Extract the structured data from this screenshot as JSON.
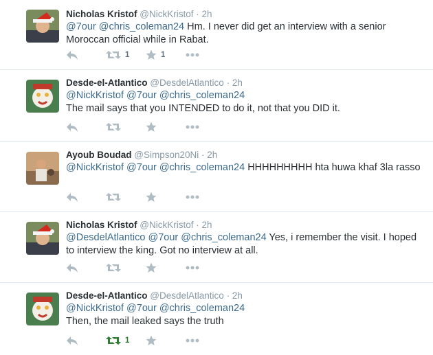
{
  "colors": {
    "mention": "#3b6a8c",
    "muted": "#8899a6",
    "icon": "#b0bcc4",
    "retweet_active": "#2e7d32",
    "divider": "#e1e8ed"
  },
  "tweets": [
    {
      "fullname": "Nicholas Kristof",
      "handle": "@NickKristof",
      "dot": "·",
      "time": "2h",
      "parts": [
        "@7our",
        " ",
        "@chris_coleman24",
        " Hm. I never did get an interview with a senior Moroccan official while in Rabat."
      ],
      "retweet_count": "1",
      "favorite_count": "1",
      "retweeted": false
    },
    {
      "fullname": "Desde-el-Atlantico",
      "handle": "@DesdelAtlantico",
      "dot": "·",
      "time": "2h",
      "parts": [
        "@NickKristof",
        " ",
        "@7our",
        " ",
        "@chris_coleman24",
        "The mail says that you INTENDED to do it, not that you DID it."
      ],
      "retweet_count": "",
      "favorite_count": "",
      "retweeted": false
    },
    {
      "fullname": "Ayoub Boudad",
      "handle": "@Simpson20Ni",
      "dot": "·",
      "time": "2h",
      "parts": [
        "@NickKristof",
        " ",
        "@7our",
        " ",
        "@chris_coleman24",
        " HHHHHHHHH hta huwa khaf 3la rasso"
      ],
      "retweet_count": "",
      "favorite_count": "",
      "retweeted": false
    },
    {
      "fullname": "Nicholas Kristof",
      "handle": "@NickKristof",
      "dot": "·",
      "time": "2h",
      "parts": [
        "@DesdelAtlantico",
        " ",
        "@7our",
        " ",
        "@chris_coleman24",
        " Yes, i remember the visit. I hoped to interview the king. Got no interview at all."
      ],
      "retweet_count": "",
      "favorite_count": "",
      "retweeted": false
    },
    {
      "fullname": "Desde-el-Atlantico",
      "handle": "@DesdelAtlantico",
      "dot": "·",
      "time": "2h",
      "parts": [
        "@NickKristof",
        " ",
        "@7our",
        " ",
        "@chris_coleman24",
        "Then, the mail leaked says the truth"
      ],
      "retweet_count": "1",
      "favorite_count": "",
      "retweeted": true
    }
  ],
  "icons": {
    "reply": "reply-icon",
    "retweet": "retweet-icon",
    "favorite": "star-icon",
    "more": "more-icon"
  }
}
